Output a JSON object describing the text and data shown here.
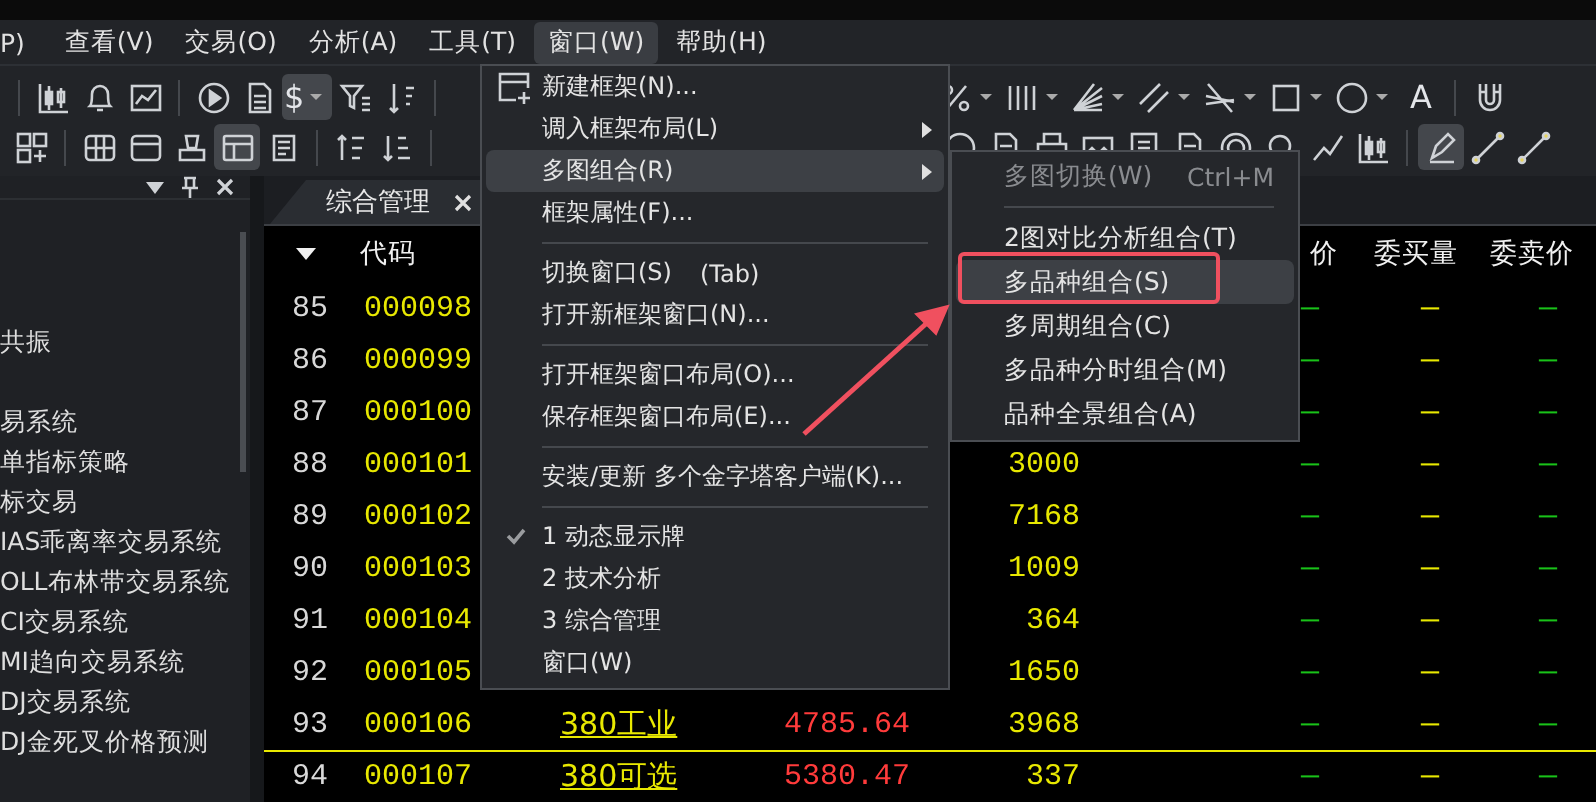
{
  "menu_bar": [
    {
      "label": "P)",
      "selected": false
    },
    {
      "label": "查看(V)",
      "selected": false
    },
    {
      "label": "交易(O)",
      "selected": false
    },
    {
      "label": "分析(A)",
      "selected": false
    },
    {
      "label": "工具(T)",
      "selected": false
    },
    {
      "label": "窗口(W)",
      "selected": true
    },
    {
      "label": "帮助(H)",
      "selected": false
    }
  ],
  "toolbar": {
    "row_1_left": [
      {
        "kind": "separator"
      },
      {
        "kind": "candlestick",
        "pressed": false
      },
      {
        "kind": "bell",
        "pressed": false
      },
      {
        "kind": "line_chart",
        "pressed": false
      },
      {
        "kind": "separator"
      },
      {
        "kind": "play",
        "pressed": false
      },
      {
        "kind": "document",
        "pressed": false
      },
      {
        "kind": "currency",
        "label": "$",
        "pressed": true
      },
      {
        "kind": "filter",
        "pressed": false
      },
      {
        "kind": "sort",
        "pressed": false
      },
      {
        "kind": "separator"
      }
    ],
    "row_1_right": [
      {
        "kind": "percent",
        "pressed": false
      },
      {
        "kind": "vertical_lines",
        "pressed": false
      },
      {
        "kind": "fan",
        "pressed": false
      },
      {
        "kind": "parallel",
        "pressed": false
      },
      {
        "kind": "crossing",
        "pressed": false
      },
      {
        "kind": "rectangle",
        "pressed": false
      },
      {
        "kind": "circle",
        "pressed": false
      },
      {
        "kind": "text",
        "label": "A",
        "pressed": false
      },
      {
        "kind": "separator"
      },
      {
        "kind": "magnet",
        "pressed": false
      }
    ],
    "row_2_left": [
      {
        "kind": "grid_add",
        "pressed": false
      },
      {
        "kind": "separator"
      },
      {
        "kind": "table",
        "pressed": false
      },
      {
        "kind": "window",
        "pressed": false
      },
      {
        "kind": "stamp",
        "pressed": false
      },
      {
        "kind": "layout",
        "pressed": true
      },
      {
        "kind": "scroll",
        "pressed": false
      },
      {
        "kind": "separator"
      },
      {
        "kind": "sort_asc",
        "pressed": false
      },
      {
        "kind": "sort_desc",
        "pressed": false
      },
      {
        "kind": "separator"
      }
    ],
    "row_2_right": [
      {
        "kind": "circle",
        "pressed": false
      },
      {
        "kind": "document",
        "pressed": false
      },
      {
        "kind": "printer",
        "pressed": false
      },
      {
        "kind": "image",
        "pressed": false
      },
      {
        "kind": "note",
        "pressed": false
      },
      {
        "kind": "document",
        "pressed": false
      },
      {
        "kind": "coin",
        "pressed": false
      },
      {
        "kind": "zoom",
        "pressed": false
      },
      {
        "kind": "trend",
        "pressed": false
      },
      {
        "kind": "candlestick",
        "pressed": false
      },
      {
        "kind": "separator"
      },
      {
        "kind": "pen",
        "pressed": true
      },
      {
        "kind": "segment",
        "pressed": false
      },
      {
        "kind": "segment",
        "pressed": false
      }
    ]
  },
  "side_panel": {
    "groups": [
      [
        "共振"
      ],
      [
        "易系统",
        "单指标策略",
        "标交易",
        "IAS乖离率交易系统",
        "OLL布林带交易系统",
        "CI交易系统",
        "MI趋向交易系统",
        "DJ交易系统",
        "DJ金死叉价格预测"
      ]
    ]
  },
  "tabs": [
    {
      "label": "综合管理",
      "selected": true
    }
  ],
  "table": {
    "columns": {
      "code": "代码",
      "column_6": "价",
      "column_7": "委买量",
      "column_8": "委卖价"
    },
    "rows": [
      {
        "no": "85",
        "code": "000098",
        "cells": [
          "—",
          "—",
          "—"
        ],
        "divider_above": false
      },
      {
        "no": "86",
        "code": "000099",
        "cells": [
          "—",
          "—",
          "—"
        ],
        "divider_above": false
      },
      {
        "no": "87",
        "code": "000100",
        "cells": [
          "—",
          "—",
          "—"
        ],
        "divider_above": false
      },
      {
        "no": "88",
        "code": "000101",
        "volume": "3000",
        "cells": [
          "—",
          "—",
          "—"
        ],
        "divider_above": false
      },
      {
        "no": "89",
        "code": "000102",
        "volume": "7168",
        "cells": [
          "—",
          "—",
          "—"
        ],
        "divider_above": false
      },
      {
        "no": "90",
        "code": "000103",
        "volume": "1009",
        "cells": [
          "—",
          "—",
          "—"
        ],
        "divider_above": false
      },
      {
        "no": "91",
        "code": "000104",
        "volume": "364",
        "cells": [
          "—",
          "—",
          "—"
        ],
        "divider_above": false
      },
      {
        "no": "92",
        "code": "000105",
        "volume": "1650",
        "cells": [
          "—",
          "—",
          "—"
        ],
        "divider_above": false
      },
      {
        "no": "93",
        "code": "000106",
        "name": "380工业",
        "price": "4785.64",
        "volume": "3968",
        "cells": [
          "—",
          "—",
          "—"
        ],
        "divider_above": false
      },
      {
        "no": "94",
        "code": "000107",
        "name": "380可选",
        "price": "5380.47",
        "volume": "337",
        "cells": [
          "—",
          "—",
          "—"
        ],
        "divider_above": true
      }
    ]
  },
  "window_menu": {
    "items": [
      {
        "kind": "icon_item",
        "label": "新建框架(N)...",
        "submenu": false,
        "highlighted": false,
        "checked": false
      },
      {
        "kind": "item",
        "label": "调入框架布局(L)",
        "submenu": true,
        "highlighted": false,
        "checked": false
      },
      {
        "kind": "item",
        "label": "多图组合(R)",
        "submenu": true,
        "highlighted": true,
        "checked": false
      },
      {
        "kind": "item",
        "label": "框架属性(F)...",
        "submenu": false,
        "highlighted": false,
        "checked": false
      },
      {
        "kind": "separator"
      },
      {
        "kind": "item",
        "label": "切换窗口(S)",
        "shortcut": "(Tab)",
        "submenu": false,
        "highlighted": false,
        "checked": false
      },
      {
        "kind": "item",
        "label": "打开新框架窗口(N)...",
        "submenu": false,
        "highlighted": false,
        "checked": false
      },
      {
        "kind": "separator"
      },
      {
        "kind": "item",
        "label": "打开框架窗口布局(O)...",
        "submenu": false,
        "highlighted": false,
        "checked": false
      },
      {
        "kind": "item",
        "label": "保存框架窗口布局(E)...",
        "submenu": false,
        "highlighted": false,
        "checked": false
      },
      {
        "kind": "separator"
      },
      {
        "kind": "item",
        "label": "安装/更新 多个金字塔客户端(K)...",
        "submenu": false,
        "highlighted": false,
        "checked": false
      },
      {
        "kind": "separator"
      },
      {
        "kind": "item",
        "label": "1 动态显示牌",
        "submenu": false,
        "highlighted": false,
        "checked": true
      },
      {
        "kind": "item",
        "label": "2 技术分析",
        "submenu": false,
        "highlighted": false,
        "checked": false
      },
      {
        "kind": "item",
        "label": "3 综合管理",
        "submenu": false,
        "highlighted": false,
        "checked": false
      },
      {
        "kind": "item",
        "label": "窗口(W)",
        "submenu": false,
        "highlighted": false,
        "checked": false
      }
    ]
  },
  "submenu": {
    "items": [
      {
        "kind": "item",
        "label": "多图切换(W)",
        "shortcut": "Ctrl+M",
        "disabled": true,
        "highlighted": false,
        "callout": false
      },
      {
        "kind": "separator"
      },
      {
        "kind": "item",
        "label": "2图对比分析组合(T)",
        "disabled": false,
        "highlighted": false,
        "callout": false
      },
      {
        "kind": "item",
        "label": "多品种组合(S)",
        "disabled": false,
        "highlighted": true,
        "callout": true
      },
      {
        "kind": "item",
        "label": "多周期组合(C)",
        "disabled": false,
        "highlighted": false,
        "callout": false
      },
      {
        "kind": "item",
        "label": "多品种分时组合(M)",
        "disabled": false,
        "highlighted": false,
        "callout": false
      },
      {
        "kind": "item",
        "label": "品种全景组合(A)",
        "disabled": false,
        "highlighted": false,
        "callout": false
      }
    ]
  }
}
